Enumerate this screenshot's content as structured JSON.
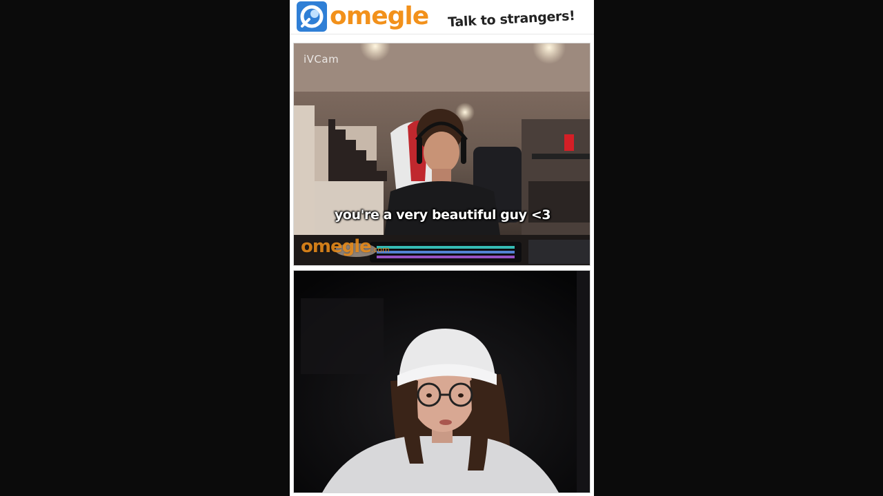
{
  "brand": {
    "name": "omegle",
    "tagline": "Talk to strangers!",
    "color": "#f2911b",
    "icon": "omegle-logo-icon"
  },
  "video_top": {
    "camera_label": "iVCam",
    "caption": "you're a very beautiful guy <3",
    "watermark_name": "omegle",
    "watermark_suffix": ".com"
  },
  "video_bottom": {
    "description_icon": "self-camera-feed"
  }
}
